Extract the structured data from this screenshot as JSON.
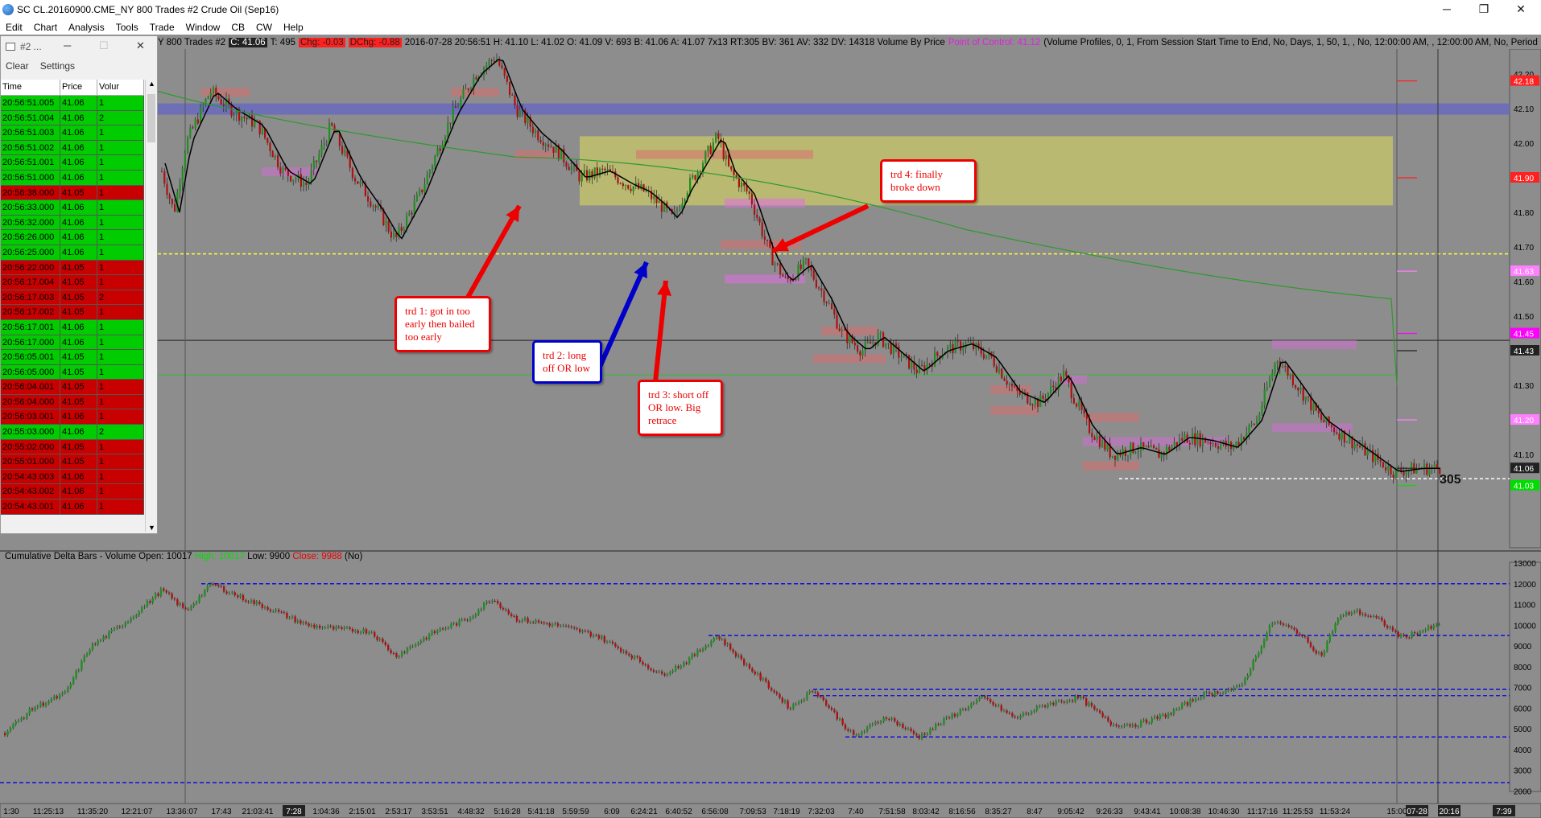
{
  "window": {
    "title": "SC CL.20160900.CME_NY  800 Trades  #2  Crude Oil (Sep16)",
    "minimize": "─",
    "maximize": "❐",
    "close": "✕"
  },
  "menu": [
    "Edit",
    "Chart",
    "Analysis",
    "Tools",
    "Trade",
    "Window",
    "CB",
    "CW",
    "Help"
  ],
  "chart_header": {
    "prefix": "Y  800 Trades  #2",
    "last": "C: 41.06",
    "tick": "T: 495",
    "chg": "Chg: -0.03",
    "dchg": "DChg: -0.88",
    "bar": "2016-07-28  20:56:51  H: 41.10  L: 41.02  O: 41.09  V: 693  B: 41.06  A: 41.07  7x13  RT:305  BV: 361  AV: 332  DV: 14318  Volume By Price",
    "poc": "Point of Control: 41.12",
    "profile": "(Volume Profiles, 0, 1, From Session Start Time to End, No, Days, 1, 50, 1, , No, 12:00:00 AM, , 12:00:00 AM, No, Period"
  },
  "ts_panel": {
    "title": "#2 ...",
    "toolbar": {
      "clear": "Clear",
      "settings": "Settings"
    },
    "columns": [
      "Time",
      "Price",
      "Volur"
    ],
    "rows": [
      [
        "20:56:51.005",
        "41.06",
        "1",
        "g"
      ],
      [
        "20:56:51.004",
        "41.06",
        "2",
        "g"
      ],
      [
        "20:56:51.003",
        "41.06",
        "1",
        "g"
      ],
      [
        "20:56:51.002",
        "41.06",
        "1",
        "g"
      ],
      [
        "20:56:51.001",
        "41.06",
        "1",
        "g"
      ],
      [
        "20:56:51.000",
        "41.06",
        "1",
        "g"
      ],
      [
        "20:56:38.000",
        "41.05",
        "1",
        "r"
      ],
      [
        "20:56:33.000",
        "41.06",
        "1",
        "g"
      ],
      [
        "20:56:32.000",
        "41.06",
        "1",
        "g"
      ],
      [
        "20:56:26.000",
        "41.06",
        "1",
        "g"
      ],
      [
        "20:56:25.000",
        "41.06",
        "1",
        "g"
      ],
      [
        "20:56:22.000",
        "41.05",
        "1",
        "r"
      ],
      [
        "20:56:17.004",
        "41.05",
        "1",
        "r"
      ],
      [
        "20:56:17.003",
        "41.05",
        "2",
        "r"
      ],
      [
        "20:56:17.002",
        "41.05",
        "1",
        "r"
      ],
      [
        "20:56:17.001",
        "41.06",
        "1",
        "g"
      ],
      [
        "20:56:17.000",
        "41.06",
        "1",
        "g"
      ],
      [
        "20:56:05.001",
        "41.05",
        "1",
        "g"
      ],
      [
        "20:56:05.000",
        "41.05",
        "1",
        "g"
      ],
      [
        "20:56:04.001",
        "41.05",
        "1",
        "r"
      ],
      [
        "20:56:04.000",
        "41.05",
        "1",
        "r"
      ],
      [
        "20:56:03.001",
        "41.06",
        "1",
        "r"
      ],
      [
        "20:55:03.000",
        "41.06",
        "2",
        "g"
      ],
      [
        "20:55:02.000",
        "41.05",
        "1",
        "r"
      ],
      [
        "20:55:01.000",
        "41.05",
        "1",
        "r"
      ],
      [
        "20:54:43.003",
        "41.06",
        "1",
        "r"
      ],
      [
        "20:54:43.002",
        "41.06",
        "1",
        "r"
      ],
      [
        "20:54:43.001",
        "41.06",
        "1",
        "r"
      ]
    ]
  },
  "annotations": [
    {
      "text": "trd 1: got in too early then bailed too early",
      "color": "red"
    },
    {
      "text": "trd 2: long off OR low",
      "color": "blue"
    },
    {
      "text": "trd 3: short off OR low. Big retrace",
      "color": "red"
    },
    {
      "text": "trd 4: finally broke down",
      "color": "red"
    }
  ],
  "price_axis": {
    "labels": [
      "42.20",
      "42.10",
      "42.00",
      "41.90",
      "41.80",
      "41.70",
      "41.60",
      "41.50",
      "41.40",
      "41.30",
      "41.20",
      "41.10"
    ],
    "badges": [
      {
        "text": "42.18",
        "bg": "#ff2020",
        "fg": "#fff"
      },
      {
        "text": "41.90",
        "bg": "#ff2020",
        "fg": "#fff"
      },
      {
        "text": "41.63",
        "bg": "#ff80ff",
        "fg": "#fff"
      },
      {
        "text": "41.45",
        "bg": "#ff00ff",
        "fg": "#fff"
      },
      {
        "text": "41.43",
        "bg": "#222",
        "fg": "#fff"
      },
      {
        "text": "41.20",
        "bg": "#ff80ff",
        "fg": "#fff"
      },
      {
        "text": "41.06",
        "bg": "#222",
        "fg": "#fff"
      },
      {
        "text": "41.03",
        "bg": "#00dd00",
        "fg": "#fff"
      }
    ],
    "bar_count": "305"
  },
  "volume_header": {
    "text": "Cumulative Delta Bars - Volume  Open: 10017",
    "high": "High: 10017",
    "low": "Low: 9900",
    "close": "Close: 9988",
    "tail": "(No)"
  },
  "delta_axis": [
    "13000",
    "12000",
    "11000",
    "10000",
    "9000",
    "8000",
    "7000",
    "6000",
    "5000",
    "4000",
    "3000",
    "2000"
  ],
  "time_axis": [
    "1:30",
    "11:25:13",
    "11:35:20",
    "12:21:07",
    "13:36:07",
    "17:43",
    "21:03:41",
    "7:28",
    "1:04:36",
    "2:15:01",
    "2:53:17",
    "3:53:51",
    "4:48:32",
    "5:16:28",
    "5:41:18",
    "5:59:59",
    "6:09",
    "6:24:21",
    "6:40:52",
    "6:56:08",
    "7:09:53",
    "7:18:19",
    "7:32:03",
    "7:40",
    "7:51:58",
    "8:03:42",
    "8:16:56",
    "8:35:27",
    "8:47",
    "9:05:42",
    "9:26:33",
    "9:43:41",
    "10:08:38",
    "10:46:30",
    "11:17:16",
    "11:25:53",
    "11:53:24",
    "15:00",
    "07-28",
    "20:16",
    "7:39"
  ],
  "colors": {
    "bg": "#8d8d8d",
    "up": "#1f8f1f",
    "down": "#b01010",
    "ma_black": "#000000",
    "ma_green": "#2e9a2e",
    "zone": "#c8c86a",
    "blue_band": "#6a6ac0"
  }
}
